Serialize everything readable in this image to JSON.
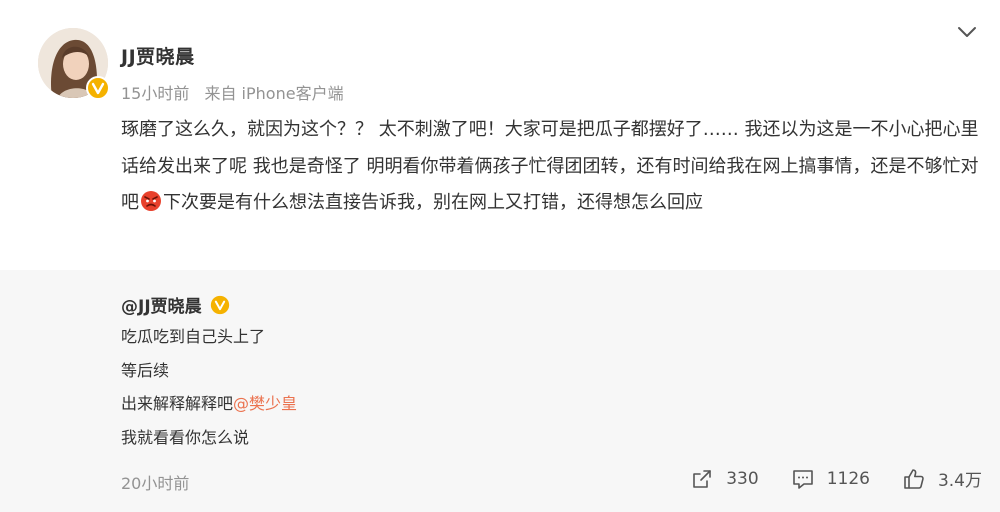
{
  "post": {
    "author": "JJ贾晓晨",
    "time": "15小时前",
    "source": "来自 iPhone客户端",
    "text_before_emoji": "琢磨了这么久，就因为这个？？ 太不刺激了吧！大家可是把瓜子都摆好了…… 我还以为这是一不小心把心里话给发出来了呢 我也是奇怪了 明明看你带着俩孩子忙得团团转，还有时间给我在网上搞事情，还是不够忙对吧",
    "emoji": "angry-face-emoji",
    "text_after_emoji": "下次要是有什么想法直接告诉我，别在网上又打错，还得想怎么回应"
  },
  "quote": {
    "author": "@JJ贾晓晨",
    "line1": "吃瓜吃到自己头上了",
    "line2": "等后续",
    "line3_text": "出来解释解释吧",
    "line3_mention": "@樊少皇",
    "line4": "我就看看你怎么说",
    "time": "20小时前",
    "repost_count": "330",
    "comment_count": "1126",
    "like_count": "3.4万"
  },
  "colors": {
    "accent": "#eb7350",
    "verified": "#f5b200",
    "muted": "#939393",
    "quote_bg": "#f7f7f7"
  },
  "icons": [
    "chevron-down-icon",
    "verified-badge-icon",
    "repost-icon",
    "comment-icon",
    "like-icon"
  ]
}
